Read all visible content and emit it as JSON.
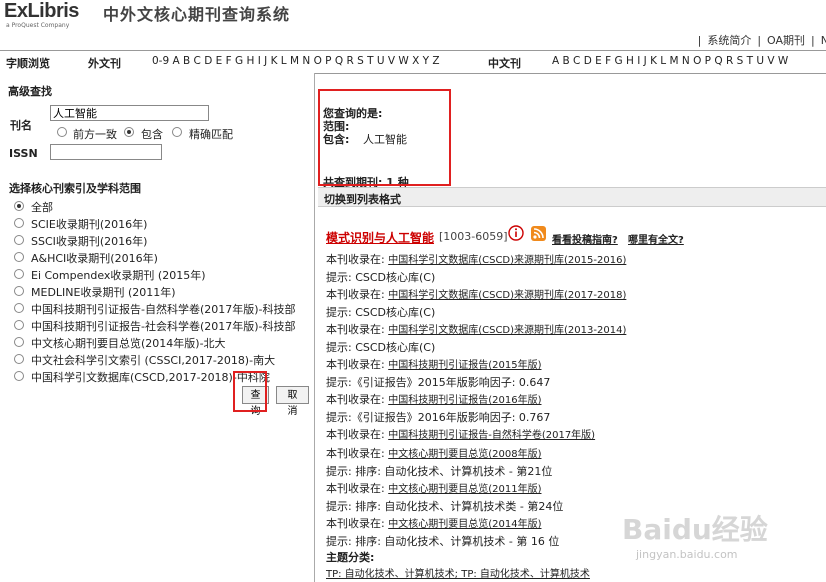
{
  "header": {
    "logo": "ExLibris",
    "logo_sub": "a ProQuest Company",
    "title": "中外文核心期刊查询系统",
    "links": [
      "|",
      "系统简介",
      "|",
      "OA期刊",
      "|",
      "N"
    ]
  },
  "nav": {
    "order_label": "字顺浏览",
    "foreign_label": "外文刊",
    "foreign_letters": "0-9  A  B  C  D  E  F  G  H  I  J  K  L  M  N  O  P  Q  R  S  T  U  V  W  X  Y  Z",
    "chinese_label": "中文刊",
    "chinese_letters": "A  B  C  D  E  F  G  H  I  J  K  L  M  N  O  P  Q  R  S  T  U  V  W"
  },
  "search": {
    "heading": "高级查找",
    "title_label": "刊名",
    "title_value": "人工智能",
    "match_options": [
      "前方一致",
      "包含",
      "精确匹配"
    ],
    "match_selected": 1,
    "issn_label": "ISSN",
    "issn_value": "",
    "scope_heading": "选择核心刊索引及学科范围",
    "scope_options": [
      "全部",
      "SCIE收录期刊(2016年)",
      "SSCI收录期刊(2016年)",
      "A&HCI收录期刊(2016年)",
      "Ei Compendex收录期刊 (2015年)",
      "MEDLINE收录期刊 (2011年)",
      "中国科技期刊引证报告-自然科学卷(2017年版)-科技部",
      "中国科技期刊引证报告-社会科学卷(2017年版)-科技部",
      "中文核心期刊要目总览(2014年版)-北大",
      "中文社会科学引文索引 (CSSCI,2017-2018)-南大",
      "中国科学引文数据库(CSCD,2017-2018)-中科院"
    ],
    "scope_selected": 0,
    "query_button": "查询",
    "cancel_button": "取消"
  },
  "results": {
    "query_label": "您查询的是:",
    "scope_label": "范围:",
    "contains_label": "包含:",
    "contains_value": "人工智能",
    "count_text": "共查到期刊: 1 种",
    "switch_text": "切换到列表格式",
    "journal": {
      "title": "模式识别与人工智能",
      "issn": "[1003-6059]",
      "guide_link": "看看投稿指南?",
      "fulltext_link": "哪里有全文?"
    },
    "lines": [
      {
        "prefix": "本刊收录在:",
        "link": "中国科学引文数据库(CSCD)来源期刊库(2015-2016)"
      },
      {
        "prefix": "提示: CSCD核心库(C)",
        "link": ""
      },
      {
        "prefix": "本刊收录在:",
        "link": "中国科学引文数据库(CSCD)来源期刊库(2017-2018)"
      },
      {
        "prefix": "提示: CSCD核心库(C)",
        "link": ""
      },
      {
        "prefix": "本刊收录在:",
        "link": "中国科学引文数据库(CSCD)来源期刊库(2013-2014)"
      },
      {
        "prefix": "提示: CSCD核心库(C)",
        "link": ""
      },
      {
        "prefix": "本刊收录在:",
        "link": "中国科技期刊引证报告(2015年版)"
      },
      {
        "prefix": "提示:《引证报告》2015年版影响因子: 0.647",
        "link": ""
      },
      {
        "prefix": "本刊收录在:",
        "link": "中国科技期刊引证报告(2016年版)"
      },
      {
        "prefix": "提示:《引证报告》2016年版影响因子: 0.767",
        "link": ""
      },
      {
        "prefix": "本刊收录在:",
        "link": "中国科技期刊引证报告-自然科学卷(2017年版)"
      },
      {
        "prefix": "本刊收录在:",
        "link": "中文核心期刊要目总览(2008年版)"
      },
      {
        "prefix": "提示: 排序: 自动化技术、计算机技术 - 第21位",
        "link": ""
      },
      {
        "prefix": "本刊收录在:",
        "link": "中文核心期刊要目总览(2011年版)"
      },
      {
        "prefix": "提示: 排序: 自动化技术、计算机技术类 - 第24位",
        "link": ""
      },
      {
        "prefix": "本刊收录在:",
        "link": "中文核心期刊要目总览(2014年版)"
      },
      {
        "prefix": "提示: 排序: 自动化技术、计算机技术 - 第 16 位",
        "link": ""
      }
    ],
    "subject_label": "主题分类:",
    "subject_value": "TP: 自动化技术、计算机技术; TP: 自动化技术、计算机技术"
  },
  "watermark": {
    "text": "Baidu经验",
    "url": "jingyan.baidu.com"
  },
  "colors": {
    "highlight": "#e02020",
    "journal_title": "#cc0000",
    "rss": "#f08a1c"
  }
}
